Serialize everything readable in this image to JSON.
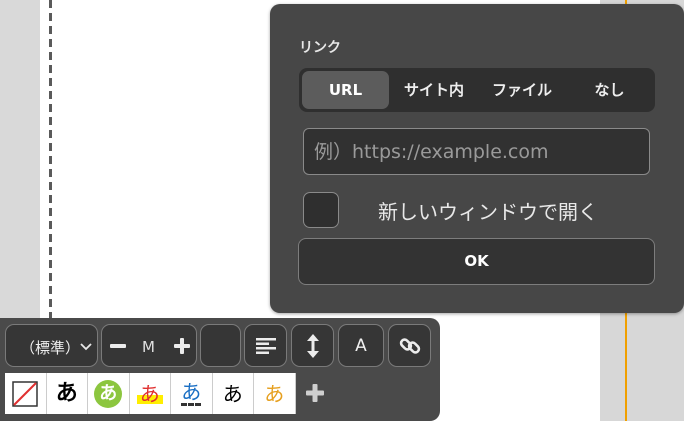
{
  "link_panel": {
    "title": "リンク",
    "tabs": [
      {
        "label": "URL",
        "active": true
      },
      {
        "label": "サイト内",
        "active": false
      },
      {
        "label": "ファイル",
        "active": false
      },
      {
        "label": "なし",
        "active": false
      }
    ],
    "url_input": {
      "value": "",
      "placeholder": "例）https://example.com"
    },
    "new_window_checkbox": {
      "checked": false,
      "label": "新しいウィンドウで開く"
    },
    "ok_label": "OK"
  },
  "toolbar": {
    "size_select": {
      "value": "（標準）",
      "icon": "chevron-down-icon"
    },
    "size_stepper": {
      "current": "M",
      "minus_icon": "minus-icon",
      "plus_icon": "plus-icon"
    },
    "align_icon": "align-left-icon",
    "line_height_icon": "vertical-arrows-icon",
    "font_label": "A",
    "link_icon": "link-icon",
    "text_styles": [
      {
        "name": "none",
        "glyph": ""
      },
      {
        "name": "outlined",
        "glyph": "あ"
      },
      {
        "name": "green-circle",
        "glyph": "あ"
      },
      {
        "name": "yellow-marker",
        "glyph": "あ"
      },
      {
        "name": "blue-underline",
        "glyph": "あ"
      },
      {
        "name": "plain-black",
        "glyph": "あ"
      },
      {
        "name": "orange",
        "glyph": "あ"
      }
    ],
    "add_style_icon": "plus-icon"
  },
  "colors": {
    "panel_bg": "#474747",
    "active_tab": "#5c5c5c",
    "guide_orange": "#f0a000",
    "style_green": "#8cc63f",
    "style_yellow": "#ffee00",
    "style_red": "#e03030",
    "style_blue": "#1a6fc4",
    "style_orange": "#e6a020"
  }
}
